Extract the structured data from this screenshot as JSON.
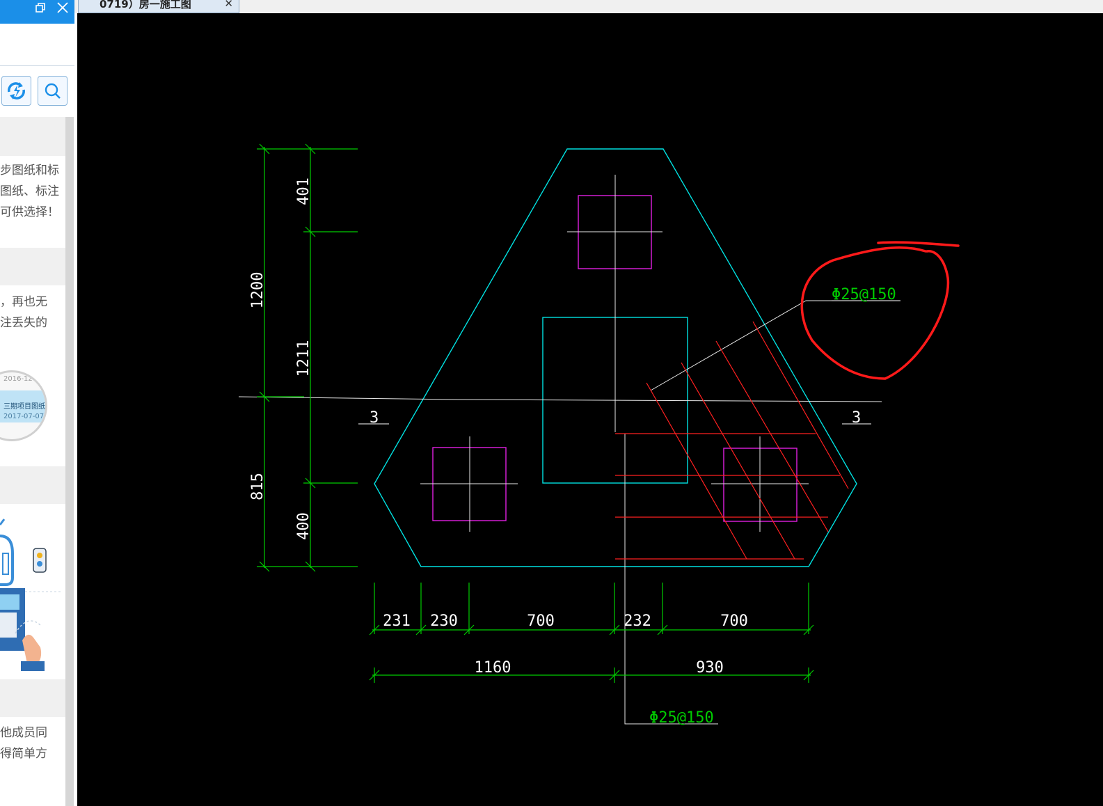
{
  "sidebar": {
    "window_restore_icon": "restore-icon",
    "window_close_icon": "close-icon",
    "sync_icon": "sync-icon",
    "search_icon": "search-icon",
    "paragraph1": [
      "步图纸和标",
      "图纸、标注",
      "可供选择！"
    ],
    "paragraph2": [
      "，再也无",
      "注丢失的"
    ],
    "zoom_card": {
      "date1": "2016-12",
      "item": "三期项目图纸",
      "date2": "2017-07-07"
    },
    "paragraph3": [
      "他成员同",
      "得简单方"
    ]
  },
  "tab": {
    "title": "0719）房一施工图",
    "close_icon": "close-icon"
  },
  "drawing": {
    "colors": {
      "background": "#000000",
      "outline": "#00e5e5",
      "dimension": "#00cc00",
      "rebar": "#ff2020",
      "pile": "#e020e0",
      "annotation": "#ff2020",
      "centerline": "#ffffff"
    },
    "vertical_dims": {
      "outer": [
        "1200",
        "815"
      ],
      "inner": [
        "401",
        "1211",
        "400"
      ]
    },
    "horizontal_dims": {
      "row1": [
        "231",
        "230",
        "700",
        "232",
        "700"
      ],
      "row2": [
        "1160",
        "930"
      ]
    },
    "rebar_label_top": "Φ25@150",
    "rebar_label_bottom": "Φ25@150",
    "section_mark_left": "3",
    "section_mark_right": "3"
  }
}
